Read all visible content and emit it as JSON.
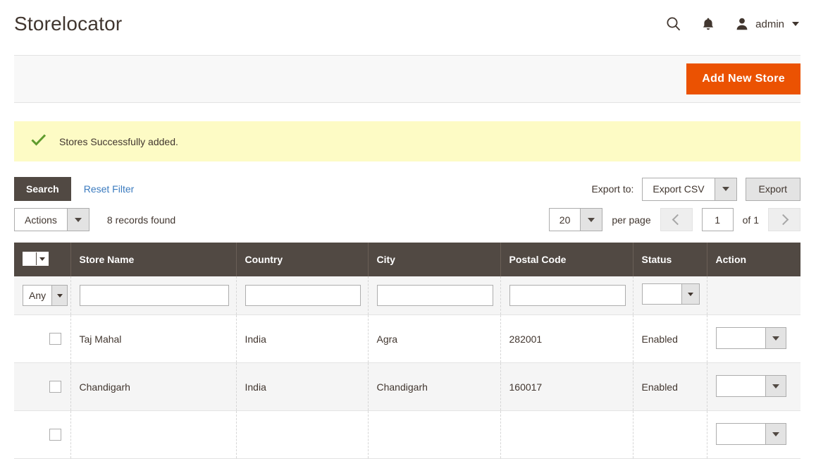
{
  "header": {
    "title": "Storelocator",
    "search_icon": "search-icon",
    "notifications_icon": "bell-icon",
    "user_icon": "user-avatar-icon",
    "user_name": "admin",
    "caret_icon": "chevron-down-icon"
  },
  "toolbar": {
    "add_new_store_label": "Add New Store",
    "accent_color": "#eb5202"
  },
  "message": {
    "icon": "check-icon",
    "icon_color": "#5f9b2d",
    "background_color": "#fdfbc5",
    "text": "Stores Successfully added."
  },
  "grid_controls": {
    "search_label": "Search",
    "reset_filter_label": "Reset Filter",
    "reset_filter_color": "#3b7bbf",
    "export_to_label": "Export to:",
    "export_format_value": "Export CSV",
    "export_button_label": "Export",
    "actions_value": "Actions",
    "records_found": "8 records found",
    "per_page_value": "20",
    "per_page_label": "per page",
    "prev_page_icon": "chevron-left-icon",
    "next_page_icon": "chevron-right-icon",
    "current_page": "1",
    "of_pages_label": "of 1"
  },
  "table": {
    "select_all_icon": "checkbox-dropdown-icon",
    "columns": [
      {
        "key": "check",
        "label": ""
      },
      {
        "key": "name",
        "label": "Store Name"
      },
      {
        "key": "country",
        "label": "Country"
      },
      {
        "key": "city",
        "label": "City"
      },
      {
        "key": "postal",
        "label": "Postal Code"
      },
      {
        "key": "status",
        "label": "Status"
      },
      {
        "key": "action",
        "label": "Action"
      }
    ],
    "filters": {
      "select_mode_value": "Any",
      "name_value": "",
      "name_placeholder": "",
      "country_value": "",
      "country_placeholder": "",
      "city_value": "",
      "city_placeholder": "",
      "postal_value": "",
      "postal_placeholder": "",
      "status_value": ""
    },
    "rows": [
      {
        "name": "Taj Mahal",
        "country": "India",
        "city": "Agra",
        "postal": "282001",
        "status": "Enabled",
        "action_value": ""
      },
      {
        "name": "Chandigarh",
        "country": "India",
        "city": "Chandigarh",
        "postal": "160017",
        "status": "Enabled",
        "action_value": ""
      },
      {
        "name": "",
        "country": "",
        "city": "",
        "postal": "",
        "status": "",
        "action_value": ""
      }
    ]
  }
}
